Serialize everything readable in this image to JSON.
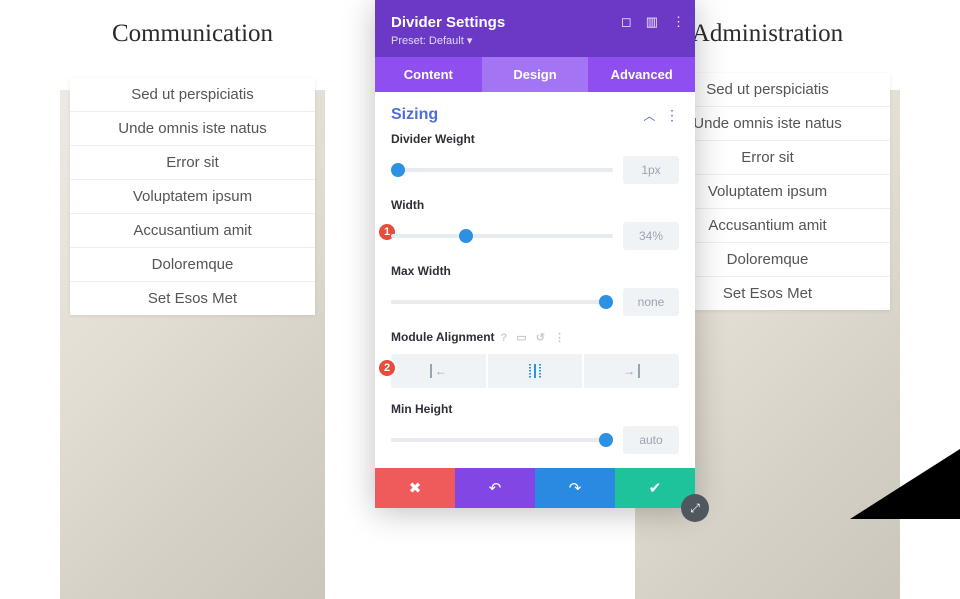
{
  "columns": {
    "left": {
      "title": "Communication"
    },
    "right": {
      "title": "Administration"
    },
    "items": [
      "Sed ut perspiciatis",
      "Unde omnis iste natus",
      "Error sit",
      "Voluptatem ipsum",
      "Accusantium amit",
      "Doloremque",
      "Set Esos Met"
    ]
  },
  "modal": {
    "title": "Divider Settings",
    "preset": "Preset: Default ▾",
    "tabs": {
      "content": "Content",
      "design": "Design",
      "advanced": "Advanced"
    },
    "section": "Sizing",
    "controls": {
      "weight": {
        "label": "Divider Weight",
        "value": "1px"
      },
      "width": {
        "label": "Width",
        "value": "34%"
      },
      "maxwidth": {
        "label": "Max Width",
        "value": "none"
      },
      "align": {
        "label": "Module Alignment"
      },
      "minheight": {
        "label": "Min Height",
        "value": "auto"
      }
    },
    "badges": {
      "one": "1",
      "two": "2"
    }
  }
}
